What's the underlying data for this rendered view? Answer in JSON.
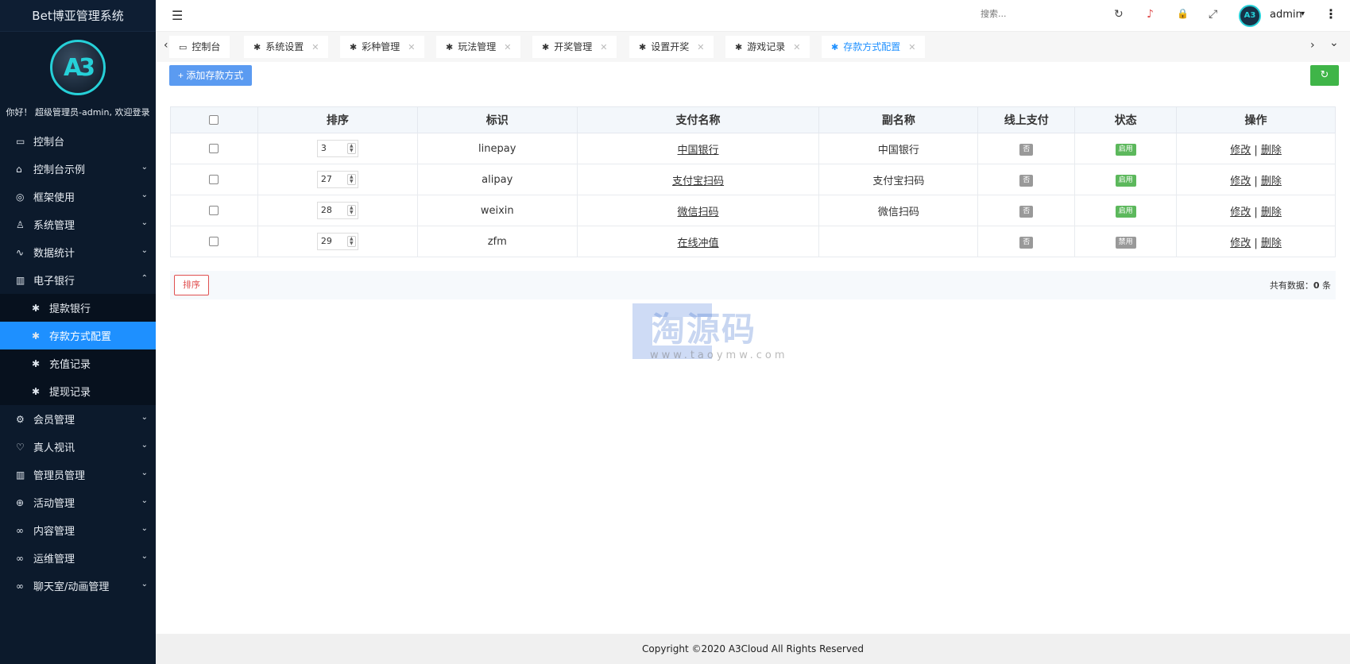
{
  "sidebar": {
    "title": "Bet博亚管理系统",
    "logo_text": "A3",
    "welcome": "你好！ 超级管理员-admin, 欢迎登录",
    "items": [
      {
        "label": "控制台",
        "icon": "monitor-icon",
        "glyph": "▭",
        "expandable": false
      },
      {
        "label": "控制台示例",
        "icon": "home-icon",
        "glyph": "⌂",
        "expandable": true,
        "chevron": "⌄"
      },
      {
        "label": "框架使用",
        "icon": "gear-icon",
        "glyph": "◎",
        "expandable": true,
        "chevron": "⌄"
      },
      {
        "label": "系统管理",
        "icon": "user-icon",
        "glyph": "♙",
        "expandable": true,
        "chevron": "⌄"
      },
      {
        "label": "数据统计",
        "icon": "pulse-icon",
        "glyph": "∿",
        "expandable": true,
        "chevron": "⌄"
      },
      {
        "label": "电子银行",
        "icon": "book-icon",
        "glyph": "▥",
        "expandable": true,
        "chevron": "⌃"
      }
    ],
    "subitems": [
      {
        "label": "提款银行",
        "glyph": "✱",
        "active": false
      },
      {
        "label": "存款方式配置",
        "glyph": "✱",
        "active": true
      },
      {
        "label": "充值记录",
        "glyph": "✱",
        "active": false
      },
      {
        "label": "提现记录",
        "glyph": "✱",
        "active": false
      }
    ],
    "items2": [
      {
        "label": "会员管理",
        "icon": "settings-icon",
        "glyph": "⚙",
        "chevron": "⌄"
      },
      {
        "label": "真人视讯",
        "icon": "people-icon",
        "glyph": "♡",
        "chevron": "⌄"
      },
      {
        "label": "管理员管理",
        "icon": "grid-icon",
        "glyph": "▥",
        "chevron": "⌄"
      },
      {
        "label": "活动管理",
        "icon": "plus-circle-icon",
        "glyph": "⊕",
        "chevron": "⌄"
      },
      {
        "label": "内容管理",
        "icon": "infinity-icon",
        "glyph": "∞",
        "chevron": "⌄"
      },
      {
        "label": "运维管理",
        "icon": "infinity-icon",
        "glyph": "∞",
        "chevron": "⌄"
      },
      {
        "label": "聊天室/动画管理",
        "icon": "infinity-icon",
        "glyph": "∞",
        "chevron": "⌄"
      }
    ]
  },
  "header": {
    "menu_glyph": "☰",
    "search_placeholder": "搜索...",
    "refresh_glyph": "↻",
    "bell_glyph": "♪",
    "lock_glyph": "🔒",
    "fullscreen_glyph": "⤢",
    "avatar_text": "A3",
    "user": "admin",
    "caret": "▾",
    "more_glyph": "⋮"
  },
  "tabs": {
    "prev": "‹",
    "next": "›",
    "dropdown": "⌄",
    "close": "✕",
    "items": [
      {
        "label": "控制台",
        "glyph": "▭",
        "closable": false,
        "active": false
      },
      {
        "label": "系统设置",
        "glyph": "✱",
        "closable": true,
        "active": false
      },
      {
        "label": "彩种管理",
        "glyph": "✱",
        "closable": true,
        "active": false
      },
      {
        "label": "玩法管理",
        "glyph": "✱",
        "closable": true,
        "active": false
      },
      {
        "label": "开奖管理",
        "glyph": "✱",
        "closable": true,
        "active": false
      },
      {
        "label": "设置开奖",
        "glyph": "✱",
        "closable": true,
        "active": false
      },
      {
        "label": "游戏记录",
        "glyph": "✱",
        "closable": true,
        "active": false
      },
      {
        "label": "存款方式配置",
        "glyph": "✱",
        "closable": true,
        "active": true
      }
    ]
  },
  "toolbar": {
    "add_label": "+ 添加存款方式",
    "refresh_glyph": "↻"
  },
  "table": {
    "columns": [
      "排序",
      "标识",
      "支付名称",
      "副名称",
      "线上支付",
      "状态",
      "操作"
    ],
    "rows": [
      {
        "sort": "3",
        "id": "linepay",
        "name": "中国银行",
        "alias": "中国银行",
        "online": "否",
        "status": "启用",
        "status_color": "#5cb85c"
      },
      {
        "sort": "27",
        "id": "alipay",
        "name": "支付宝扫码",
        "alias": "支付宝扫码",
        "online": "否",
        "status": "启用",
        "status_color": "#5cb85c"
      },
      {
        "sort": "28",
        "id": "weixin",
        "name": "微信扫码",
        "alias": "微信扫码",
        "online": "否",
        "status": "启用",
        "status_color": "#5cb85c"
      },
      {
        "sort": "29",
        "id": "zfm",
        "name": "在线冲值",
        "alias": "",
        "online": "否",
        "status": "禁用",
        "status_color": "#999999"
      }
    ],
    "edit_label": "修改",
    "sep": " | ",
    "delete_label": "删除",
    "spin_up": "▲",
    "spin_down": "▼"
  },
  "footer_bar": {
    "sort_label": "排序",
    "total_prefix": "共有数据：",
    "total_count": "0",
    "total_suffix": " 条"
  },
  "watermark": {
    "text": "淘源码",
    "url": "www.taoymw.com"
  },
  "copyright": "Copyright ©2020 A3Cloud All Rights Reserved",
  "colors": {
    "sidebar_bg": "#0c1a2c",
    "accent": "#1e90ff",
    "add_button": "#5b9bf1",
    "refresh_button": "#3fb548",
    "danger": "#e05050"
  }
}
